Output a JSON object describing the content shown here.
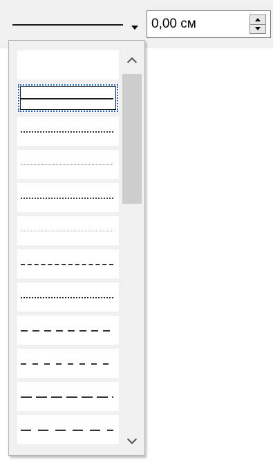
{
  "line_style_combo": {
    "selected_style": "continuous",
    "dropdown_icon": "triangle-down-icon"
  },
  "line_width": {
    "value": "0,00 см",
    "spin_up_icon": "triangle-up-icon",
    "spin_down_icon": "triangle-down-icon"
  },
  "style_list": {
    "items": [
      {
        "style": "none"
      },
      {
        "style": "continuous",
        "selected": true
      },
      {
        "style": "dot-fine"
      },
      {
        "style": "dot-light"
      },
      {
        "style": "dot"
      },
      {
        "style": "dot-sparse"
      },
      {
        "style": "dash-fine"
      },
      {
        "style": "dash-dot-fine"
      },
      {
        "style": "dash"
      },
      {
        "style": "dash-sparse"
      },
      {
        "style": "long-dash"
      },
      {
        "style": "long-dash-sparse"
      }
    ]
  },
  "scrollbar": {
    "up_icon": "chevron-up-icon",
    "down_icon": "chevron-down-icon"
  }
}
